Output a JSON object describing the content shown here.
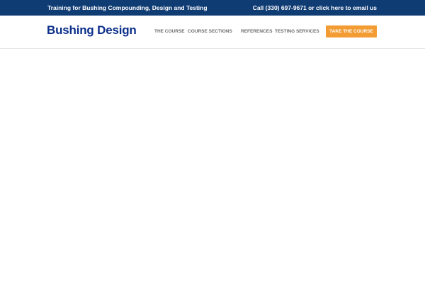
{
  "topbar": {
    "tagline": "Training for Bushing Compounding, Design and Testing",
    "contact": "Call (330) 697-9671 or click here to email us",
    "background_color": "#0f3c73"
  },
  "header": {
    "logo_text": "Bushing Design",
    "logo_color": "#0c2f8a"
  },
  "nav": {
    "items": [
      {
        "label": "THE COURSE"
      },
      {
        "label": "COURSE SECTIONS"
      },
      {
        "label": "REFERENCES"
      },
      {
        "label": "TESTING SERVICES"
      }
    ],
    "cta_label": "TAKE THE COURSE",
    "cta_color": "#f39c34"
  }
}
